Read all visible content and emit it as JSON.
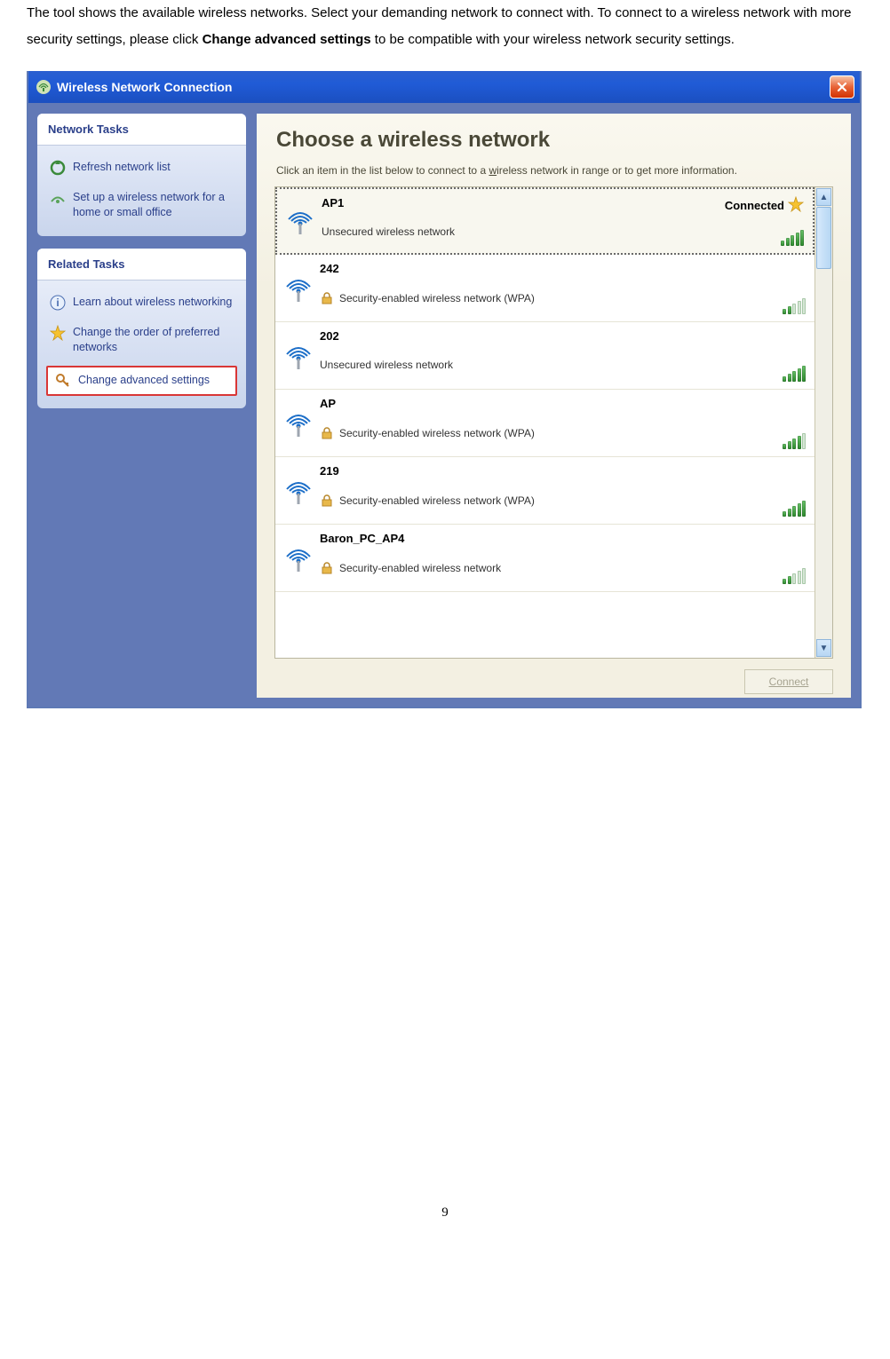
{
  "doc": {
    "para_a": "The tool shows the available wireless networks. Select your demanding network to connect with. To connect to a wireless network with more security settings, please click ",
    "bold": "Change advanced settings",
    "para_b": " to be compatible with your wireless network security settings."
  },
  "window": {
    "title": "Wireless Network Connection",
    "close": "X"
  },
  "sidebar": {
    "panel1": {
      "title": "Network Tasks",
      "items": [
        {
          "label": "Refresh network list",
          "icon": "refresh"
        },
        {
          "label": "Set up a wireless network for a home or small office",
          "icon": "setup"
        }
      ]
    },
    "panel2": {
      "title": "Related Tasks",
      "items": [
        {
          "label": "Learn about wireless networking",
          "icon": "info"
        },
        {
          "label": "Change the order of preferred networks",
          "icon": "star"
        },
        {
          "label": "Change advanced settings",
          "icon": "key",
          "highlight": true
        }
      ]
    }
  },
  "main": {
    "heading": "Choose a wireless network",
    "instr_a": "Click an item in the list below to connect to a ",
    "instr_u": "w",
    "instr_b": "ireless network in range or to get more information.",
    "networks": [
      {
        "name": "AP1",
        "security": "Unsecured wireless network",
        "locked": false,
        "status": "Connected",
        "bars": 5,
        "selected": true
      },
      {
        "name": "242",
        "security": "Security-enabled wireless network (WPA)",
        "locked": true,
        "status": "",
        "bars": 2,
        "selected": false
      },
      {
        "name": "202",
        "security": "Unsecured wireless network",
        "locked": false,
        "status": "",
        "bars": 5,
        "selected": false
      },
      {
        "name": "AP",
        "security": "Security-enabled wireless network (WPA)",
        "locked": true,
        "status": "",
        "bars": 4,
        "selected": false
      },
      {
        "name": "219",
        "security": "Security-enabled wireless network (WPA)",
        "locked": true,
        "status": "",
        "bars": 5,
        "selected": false
      },
      {
        "name": "Baron_PC_AP4",
        "security": "Security-enabled wireless network",
        "locked": true,
        "status": "",
        "bars": 2,
        "selected": false
      }
    ],
    "connect": "Connect"
  },
  "page_number": "9"
}
